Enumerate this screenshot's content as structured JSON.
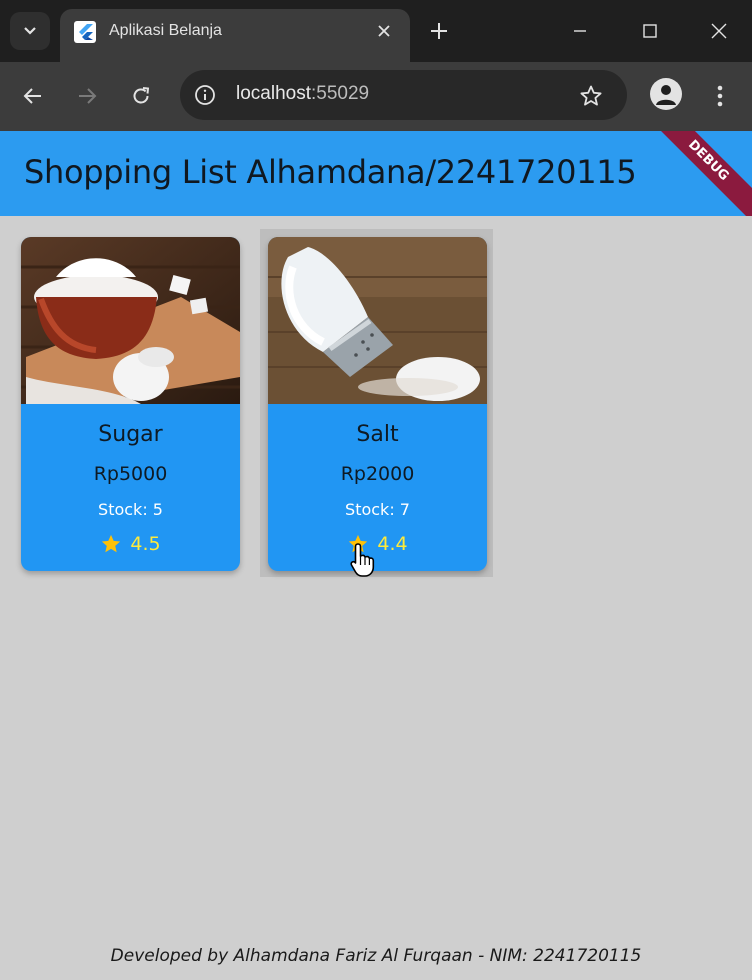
{
  "browser": {
    "tab_title": "Aplikasi Belanja",
    "url_host": "localhost",
    "url_port": ":55029"
  },
  "app": {
    "title": "Shopping List Alhamdana/2241720115",
    "debug_label": "DEBUG",
    "accent_color": "#2c9bf0",
    "card_color": "#2196f3",
    "rating_color": "#ffeb3b"
  },
  "products": [
    {
      "name": "Sugar",
      "price": "Rp5000",
      "stock": "Stock: 5",
      "rating": "4.5",
      "image_icon": "sugar-bowl-photo"
    },
    {
      "name": "Salt",
      "price": "Rp2000",
      "stock": "Stock: 7",
      "rating": "4.4",
      "image_icon": "salt-shaker-photo"
    }
  ],
  "footer": {
    "text": "Developed by Alhamdana Fariz Al Furqaan - NIM: 2241720115"
  }
}
